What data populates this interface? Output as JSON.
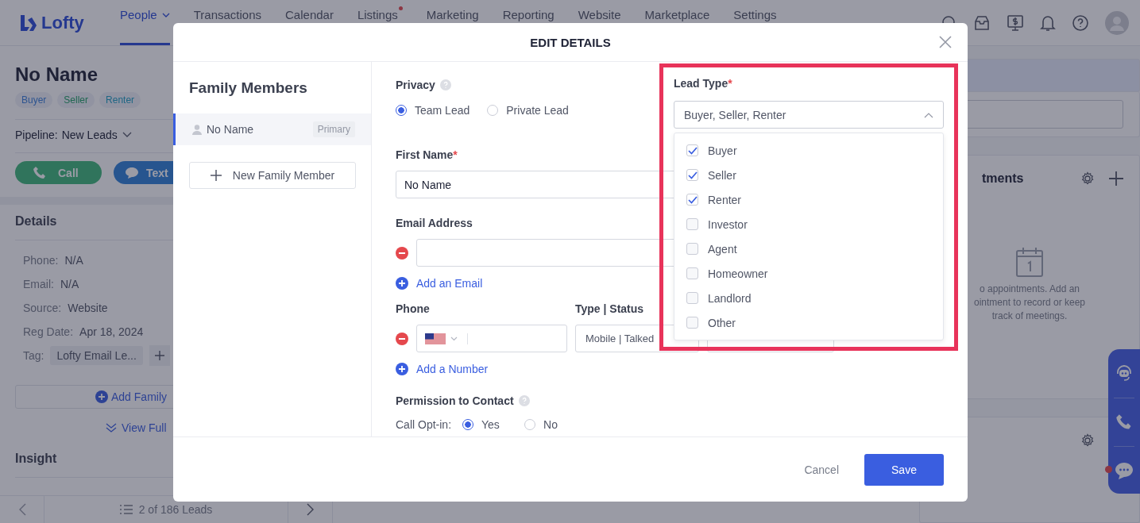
{
  "app": {
    "brand": "Lofty"
  },
  "nav": [
    {
      "label": "People",
      "selected": true,
      "has_menu": true,
      "notification": false
    },
    {
      "label": "Transactions",
      "selected": false,
      "has_menu": false,
      "notification": false
    },
    {
      "label": "Calendar",
      "selected": false,
      "has_menu": false,
      "notification": false
    },
    {
      "label": "Listings",
      "selected": false,
      "has_menu": false,
      "notification": true
    },
    {
      "label": "Marketing",
      "selected": false,
      "has_menu": false,
      "notification": false
    },
    {
      "label": "Reporting",
      "selected": false,
      "has_menu": false,
      "notification": false
    },
    {
      "label": "Website",
      "selected": false,
      "has_menu": false,
      "notification": false
    },
    {
      "label": "Marketplace",
      "selected": false,
      "has_menu": false,
      "notification": false
    },
    {
      "label": "Settings",
      "selected": false,
      "has_menu": false,
      "notification": false
    }
  ],
  "lead": {
    "name": "No Name",
    "tags": [
      {
        "label": "Buyer",
        "kind": "buyer"
      },
      {
        "label": "Seller",
        "kind": "seller"
      },
      {
        "label": "Renter",
        "kind": "renter"
      }
    ],
    "pipeline_label": "Pipeline:",
    "pipeline_value": "New Leads",
    "actions": [
      {
        "label": "Call",
        "kind": "call"
      },
      {
        "label": "Text",
        "kind": "text"
      }
    ],
    "details_title": "Details",
    "details": [
      {
        "label": "Phone:",
        "value": "N/A",
        "kind": "text"
      },
      {
        "label": "Email:",
        "value": "N/A",
        "kind": "text"
      },
      {
        "label": "Source:",
        "value": "Website",
        "kind": "text"
      },
      {
        "label": "Reg Date:",
        "value": "Apr 18, 2024",
        "kind": "text"
      },
      {
        "label": "Tag:",
        "value": "Lofty Email Le...",
        "kind": "tag"
      }
    ],
    "add_family": "Add Family",
    "view_full": "View Full",
    "insight_title": "Insight"
  },
  "pager": {
    "text": "2 of 186 Leads"
  },
  "appointments": {
    "title": "tments",
    "empty_text": "o appointments. Add an ointment to record or keep track of meetings."
  },
  "modal": {
    "title": "EDIT DETAILS",
    "family_title": "Family Members",
    "members": [
      {
        "name": "No Name",
        "badge": "Primary",
        "selected": true
      }
    ],
    "new_member": "New Family Member",
    "privacy": {
      "label": "Privacy",
      "options": [
        {
          "label": "Team Lead",
          "selected": true
        },
        {
          "label": "Private Lead",
          "selected": false
        }
      ]
    },
    "first_name": {
      "label": "First Name",
      "mark": "*",
      "value": "No Name"
    },
    "email": {
      "label": "Email Address",
      "add_label": "Add an Email"
    },
    "phone": {
      "label": "Phone",
      "type_label": "Type | Status",
      "type_value": "Mobile | Talked",
      "add_label": "Add a Number"
    },
    "permission": {
      "label": "Permission to Contact",
      "call_label": "Call Opt-in:",
      "options": [
        {
          "label": "Yes",
          "selected": true
        },
        {
          "label": "No",
          "selected": false
        }
      ]
    },
    "lead_type": {
      "label": "Lead Type",
      "mark": "*",
      "value": "Buyer, Seller, Renter",
      "expanded": true,
      "options": [
        {
          "label": "Buyer",
          "checked": true
        },
        {
          "label": "Seller",
          "checked": true
        },
        {
          "label": "Renter",
          "checked": true
        },
        {
          "label": "Investor",
          "checked": false
        },
        {
          "label": "Agent",
          "checked": false
        },
        {
          "label": "Homeowner",
          "checked": false
        },
        {
          "label": "Landlord",
          "checked": false
        },
        {
          "label": "Other",
          "checked": false
        }
      ]
    },
    "cancel": "Cancel",
    "save": "Save"
  }
}
